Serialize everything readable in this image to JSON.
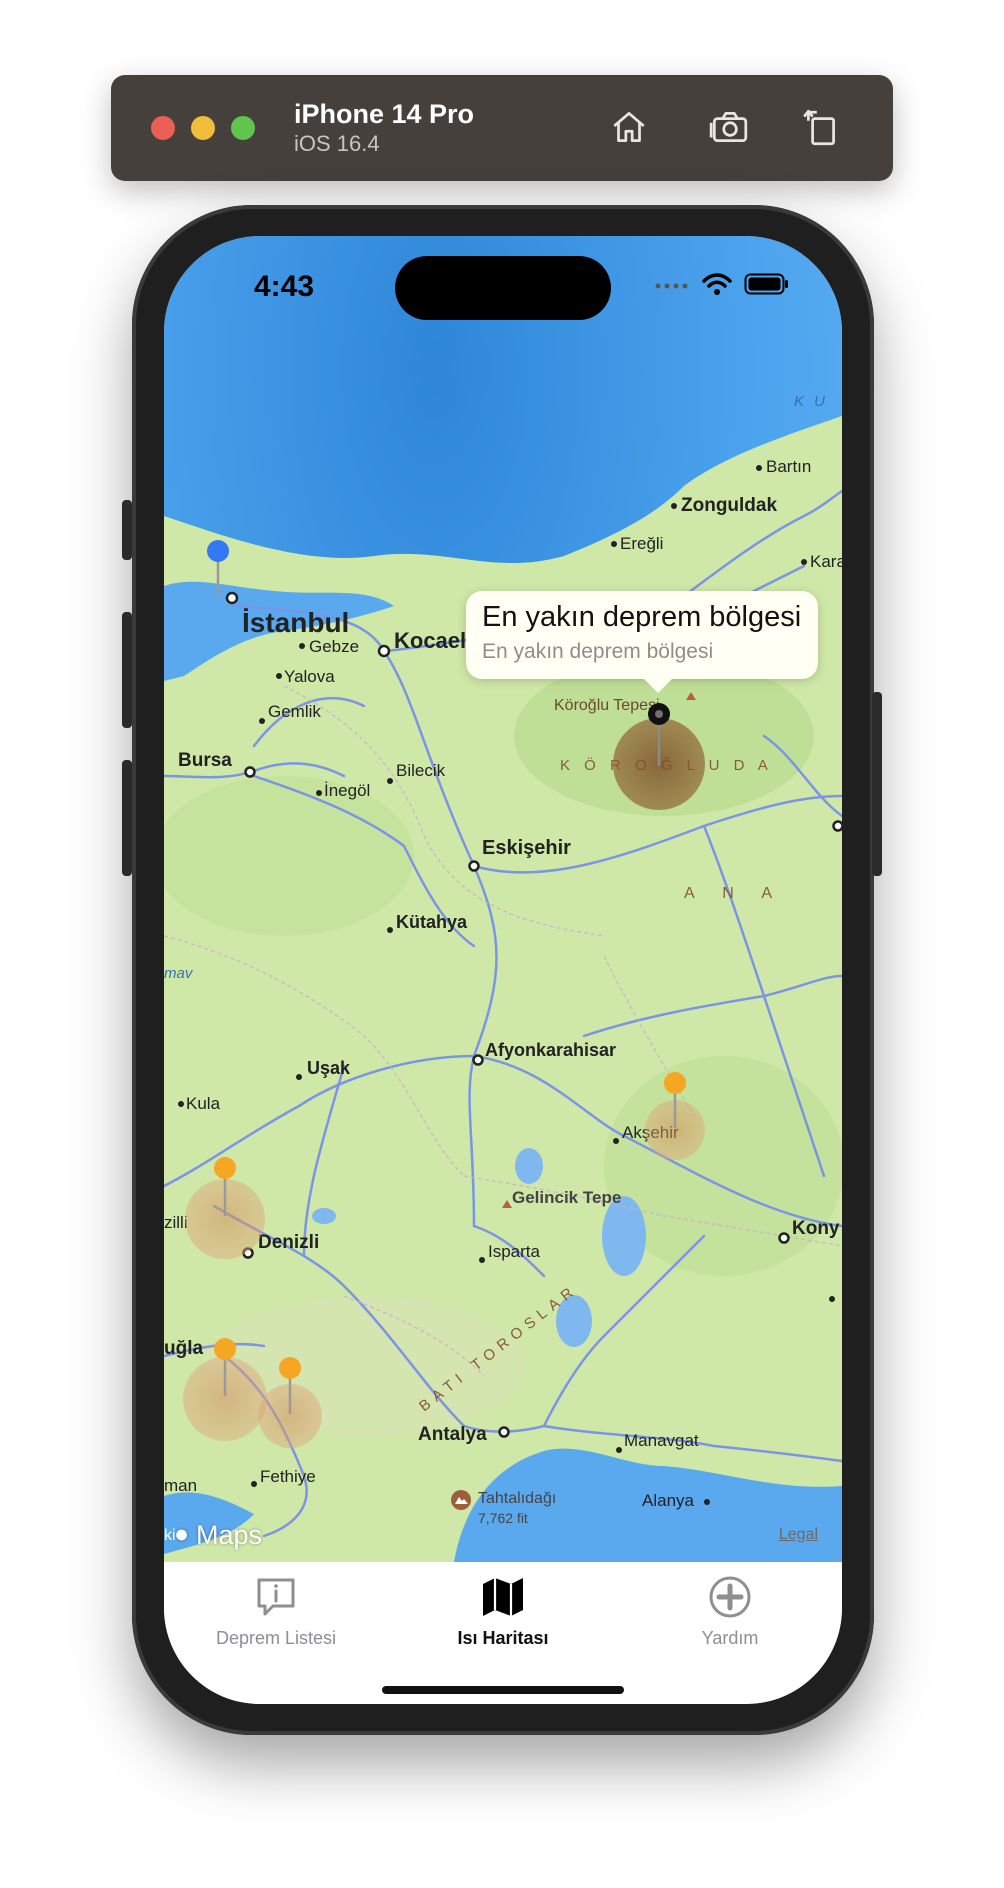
{
  "simulator": {
    "device_name": "iPhone 14 Pro",
    "os_version": "iOS 16.4",
    "buttons": {
      "home": "home-icon",
      "screenshot": "camera-icon",
      "rotate": "rotate-icon"
    }
  },
  "status_bar": {
    "time": "4:43",
    "icons": [
      "cellular-icon",
      "wifi-icon",
      "battery-icon"
    ]
  },
  "map": {
    "labels": {
      "bartin": "Bartın",
      "zonguldak": "Zonguldak",
      "eregli": "Ereğli",
      "kara": "Kara",
      "ku": "K U",
      "istanbul": "İstanbul",
      "kocaeli": "Kocael",
      "gebze": "Gebze",
      "yalova": "Yalova",
      "gemlik": "Gemlik",
      "bursa": "Bursa",
      "inegol": "İnegöl",
      "bilecik": "Bilecik",
      "koroglu_tepesi": "Köroğlu Tepesi",
      "koroglu_mountains": "K Ö R O Ğ L U   D A",
      "eskisehir": "Eskişehir",
      "anadolu": "A N A",
      "kutahya": "Kütahya",
      "mav": "mav",
      "usak": "Uşak",
      "afyonkarahisar": "Afyonkarahisar",
      "kula": "Kula",
      "aksehir": "Akşehir",
      "gelincik_tepe": "Gelincik Tepe",
      "zilli": "zilli",
      "denizli": "Denizli",
      "konya": "Kony",
      "isparta": "Isparta",
      "mugla": "uğla",
      "bati_toroslar": "BATI TOROSLAR",
      "antalya": "Antalya",
      "manavgat": "Manavgat",
      "man": "man",
      "fethiye": "Fethiye",
      "tahtalidagi": "Tahtalıdağı",
      "tahtalidagi_elev": "7,762 fit",
      "alanya": "Alanya",
      "ki": "ki"
    },
    "callout": {
      "title": "En yakın deprem bölgesi",
      "subtitle": "En yakın deprem bölgesi"
    },
    "attribution": {
      "brand": "Maps",
      "legal": "Legal"
    },
    "colors": {
      "sea": "#4ba2ee",
      "land": "#cfe8a8",
      "road": "#7b95e6",
      "pin_orange": "#f5a623",
      "pin_blue": "#3478f6",
      "heat_dark": "#8b5a2b"
    }
  },
  "tabbar": {
    "tabs": [
      {
        "label": "Deprem Listesi",
        "icon": "info-bubble-icon",
        "active": false
      },
      {
        "label": "Isı Haritası",
        "icon": "map-icon",
        "active": true
      },
      {
        "label": "Yardım",
        "icon": "plus-circle-icon",
        "active": false
      }
    ]
  }
}
